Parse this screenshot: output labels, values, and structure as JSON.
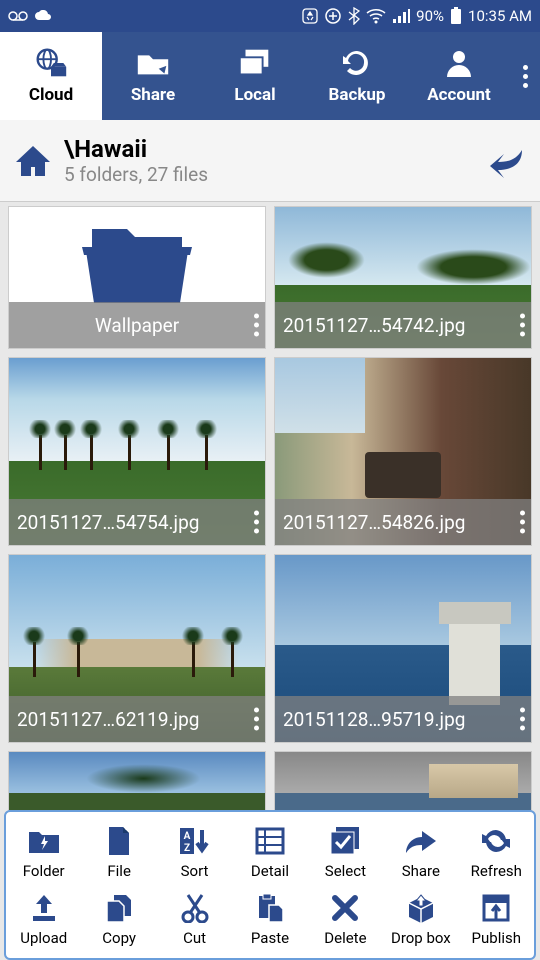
{
  "status": {
    "battery_pct": "90%",
    "time": "10:35 AM"
  },
  "tabs": {
    "cloud": "Cloud",
    "share": "Share",
    "local": "Local",
    "backup": "Backup",
    "account": "Account"
  },
  "path": {
    "name": "\\Hawaii",
    "subtitle": "5 folders, 27 files"
  },
  "tiles": [
    {
      "label": "Wallpaper",
      "is_folder": true
    },
    {
      "label": "20151127…54742.jpg",
      "is_folder": false
    },
    {
      "label": "20151127…54754.jpg",
      "is_folder": false
    },
    {
      "label": "20151127…54826.jpg",
      "is_folder": false
    },
    {
      "label": "20151127…62119.jpg",
      "is_folder": false
    },
    {
      "label": "20151128…95719.jpg",
      "is_folder": false
    }
  ],
  "toolbar": {
    "row1": [
      "Folder",
      "File",
      "Sort",
      "Detail",
      "Select",
      "Share",
      "Refresh"
    ],
    "row2": [
      "Upload",
      "Copy",
      "Cut",
      "Paste",
      "Delete",
      "Drop box",
      "Publish"
    ]
  }
}
